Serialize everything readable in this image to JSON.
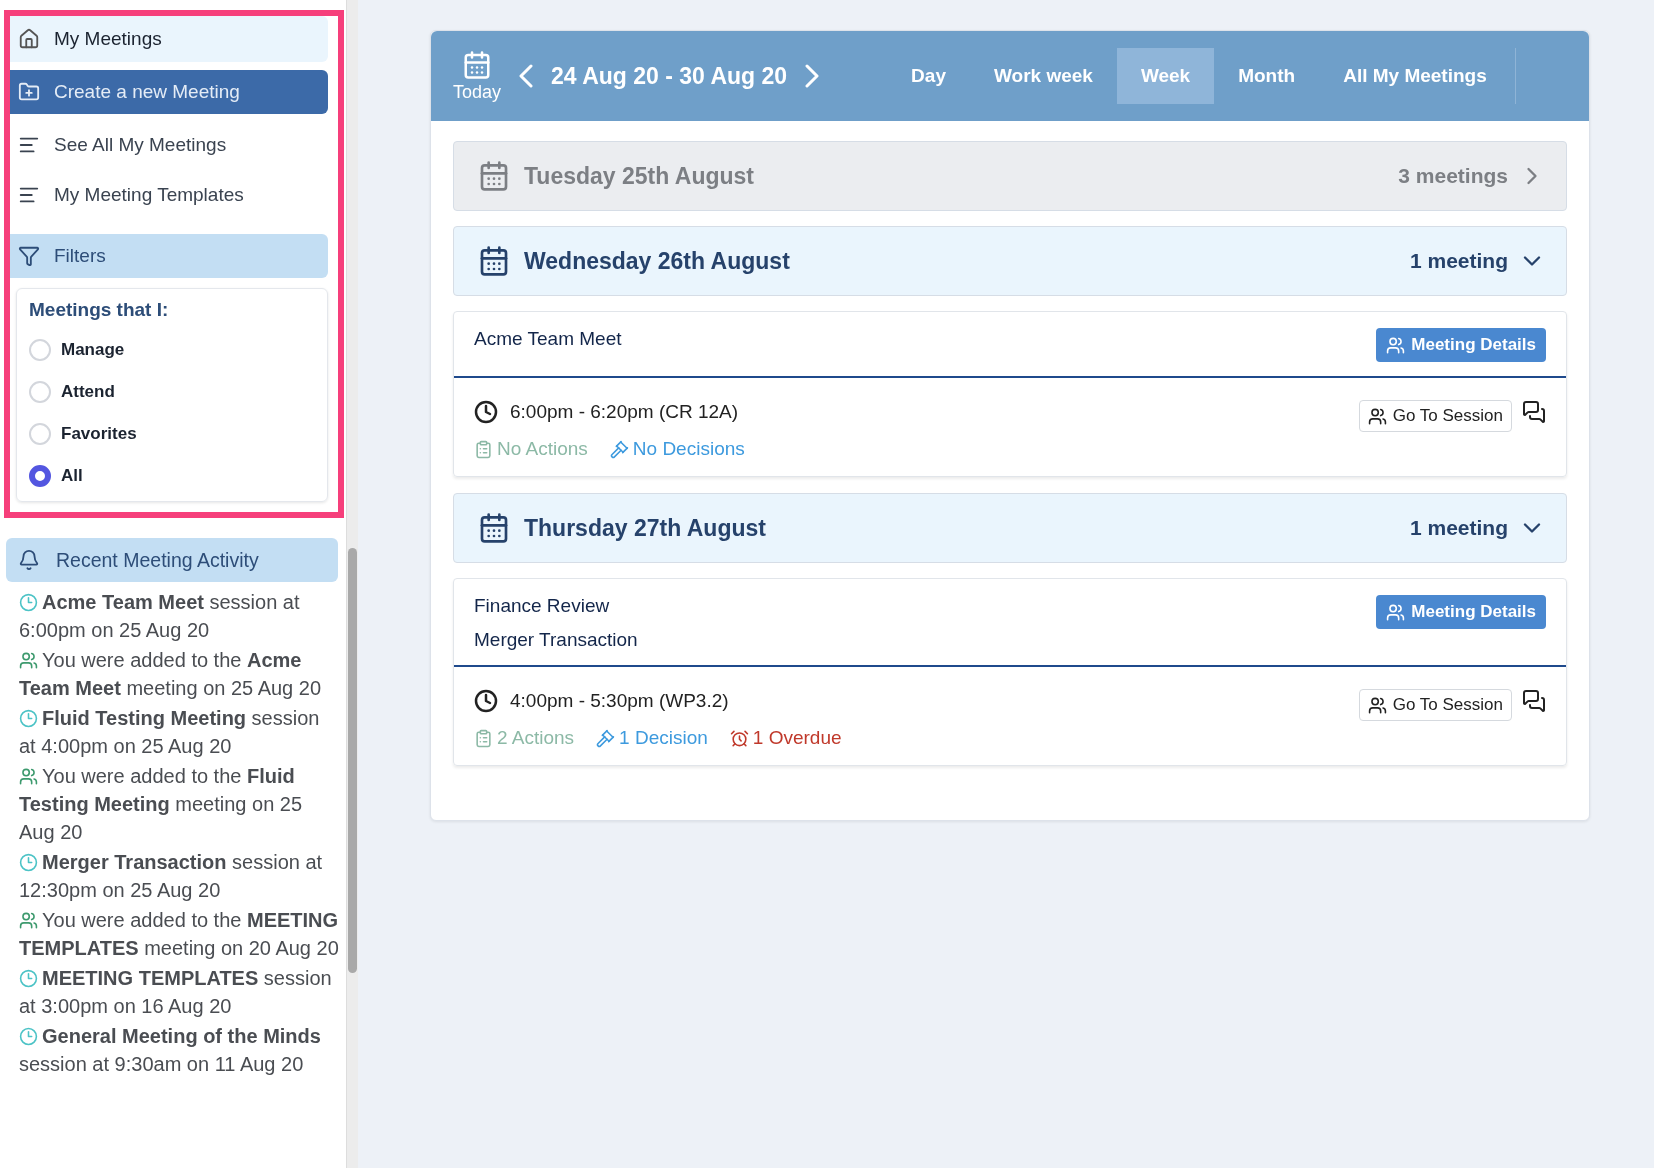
{
  "sidebar": {
    "nav": [
      {
        "kind": "home",
        "label": "My Meetings"
      },
      {
        "kind": "create",
        "label": "Create a new Meeting"
      },
      {
        "kind": "list",
        "label": "See All My Meetings"
      },
      {
        "kind": "list",
        "label": "My Meeting Templates"
      }
    ],
    "filters": {
      "title": "Filters",
      "heading": "Meetings that I:",
      "options": [
        {
          "label": "Manage",
          "selected": false
        },
        {
          "label": "Attend",
          "selected": false
        },
        {
          "label": "Favorites",
          "selected": false
        },
        {
          "label": "All",
          "selected": true
        }
      ]
    },
    "activity": {
      "title": "Recent Meeting Activity",
      "items": [
        {
          "kind": "session",
          "text": "**Acme Team Meet** session at 6:00pm on 25 Aug 20"
        },
        {
          "kind": "added",
          "text": "You were added to the **Acme Team Meet** meeting on 25 Aug 20"
        },
        {
          "kind": "session",
          "text": "**Fluid Testing Meeting** session at 4:00pm on 25 Aug 20"
        },
        {
          "kind": "added",
          "text": "You were added to the **Fluid Testing Meeting** meeting on 25 Aug 20"
        },
        {
          "kind": "session",
          "text": "**Merger Transaction** session at 12:30pm on 25 Aug 20"
        },
        {
          "kind": "added",
          "text": "You were added to the **MEETING TEMPLATES** meeting on 20 Aug 20"
        },
        {
          "kind": "session",
          "text": "**MEETING TEMPLATES** session at 3:00pm on 16 Aug 20"
        },
        {
          "kind": "session",
          "text": "**General Meeting of the Minds** session at 9:30am on 11 Aug 20"
        }
      ]
    }
  },
  "calendar": {
    "today": "Today",
    "range": "24 Aug 20 - 30 Aug 20",
    "views": [
      {
        "label": "Day",
        "selected": false
      },
      {
        "label": "Work week",
        "selected": false
      },
      {
        "label": "Week",
        "selected": true
      },
      {
        "label": "Month",
        "selected": false
      },
      {
        "label": "All My Meetings",
        "selected": false
      }
    ],
    "days": [
      {
        "title": "Tuesday 25th August",
        "count": "3 meetings",
        "expanded": false
      },
      {
        "title": "Wednesday 26th August",
        "count": "1 meeting",
        "expanded": true,
        "meetings": [
          {
            "titles": [
              "Acme Team Meet"
            ],
            "details_button": "Meeting Details",
            "time": "6:00pm - 6:20pm (CR 12A)",
            "session_button": "Go To Session",
            "stats": [
              {
                "kind": "actions",
                "text": "No Actions"
              },
              {
                "kind": "decisions",
                "text": "No Decisions"
              }
            ]
          }
        ]
      },
      {
        "title": "Thursday 27th August",
        "count": "1 meeting",
        "expanded": true,
        "meetings": [
          {
            "titles": [
              "Finance Review",
              "Merger Transaction"
            ],
            "details_button": "Meeting Details",
            "time": "4:00pm - 5:30pm (WP3.2)",
            "session_button": "Go To Session",
            "stats": [
              {
                "kind": "actions",
                "text": "2 Actions"
              },
              {
                "kind": "decisions",
                "text": "1 Decision"
              },
              {
                "kind": "overdue",
                "text": "1 Overdue"
              }
            ]
          }
        ]
      }
    ]
  }
}
